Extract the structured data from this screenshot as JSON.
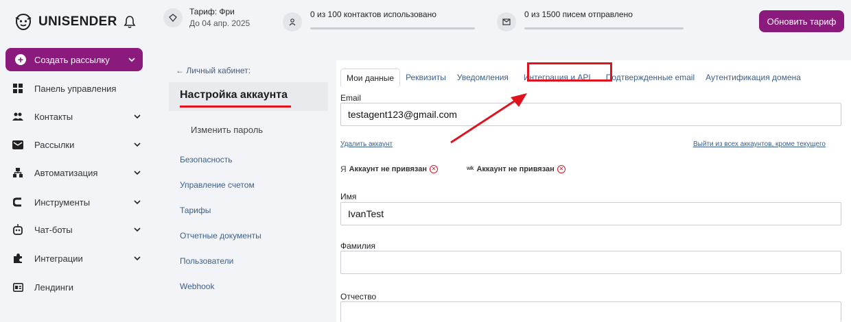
{
  "brand": {
    "name": "UNISENDER"
  },
  "plan": {
    "label": "Тариф: Фри",
    "until": "До 04 апр. 2025"
  },
  "stats": {
    "contacts": "0 из 100 контактов использовано",
    "emails": "0 из 1500 писем отправлено"
  },
  "header": {
    "upgrade_label": "Обновить тариф"
  },
  "sidebar": {
    "create_label": "Создать рассылку",
    "items": [
      {
        "label": "Панель управления",
        "icon": "dashboard-icon"
      },
      {
        "label": "Контакты",
        "icon": "contacts-icon"
      },
      {
        "label": "Рассылки",
        "icon": "mailings-icon"
      },
      {
        "label": "Автоматизация",
        "icon": "automation-icon"
      },
      {
        "label": "Инструменты",
        "icon": "tools-icon"
      },
      {
        "label": "Чат-боты",
        "icon": "chatbot-icon"
      },
      {
        "label": "Интеграции",
        "icon": "puzzle-icon"
      },
      {
        "label": "Лендинги",
        "icon": "landing-icon"
      }
    ]
  },
  "settings_menu": {
    "back": "← Личный кабинет:",
    "title": "Настройка аккаунта",
    "sub": "Изменить пароль",
    "items": [
      "Безопасность",
      "Управление счетом",
      "Тарифы",
      "Отчетные документы",
      "Пользователи",
      "Webhook"
    ]
  },
  "tabs": [
    "Мои данные",
    "Реквизиты",
    "Уведомления",
    "Интеграция и API",
    "Подтвержденные email",
    "Аутентификация домена"
  ],
  "form": {
    "email_label": "Email",
    "email_value": "testagent123@gmail.com",
    "delete_account": "Удалить аккаунт",
    "logout_others": "Выйти из всех аккаунтов, кроме текущего",
    "yandex_brand": "Я",
    "yandex_status": "Аккаунт не привязан",
    "vk_brand": "ʷᵏ",
    "vk_status": "Аккаунт не привязан",
    "first_name_label": "Имя",
    "first_name_value": "IvanTest",
    "last_name_label": "Фамилия",
    "last_name_value": "",
    "middle_name_label": "Отчество",
    "middle_name_value": ""
  },
  "colors": {
    "accent": "#8a1a7c",
    "highlight": "#e0121e",
    "link": "#3a5f8c"
  }
}
